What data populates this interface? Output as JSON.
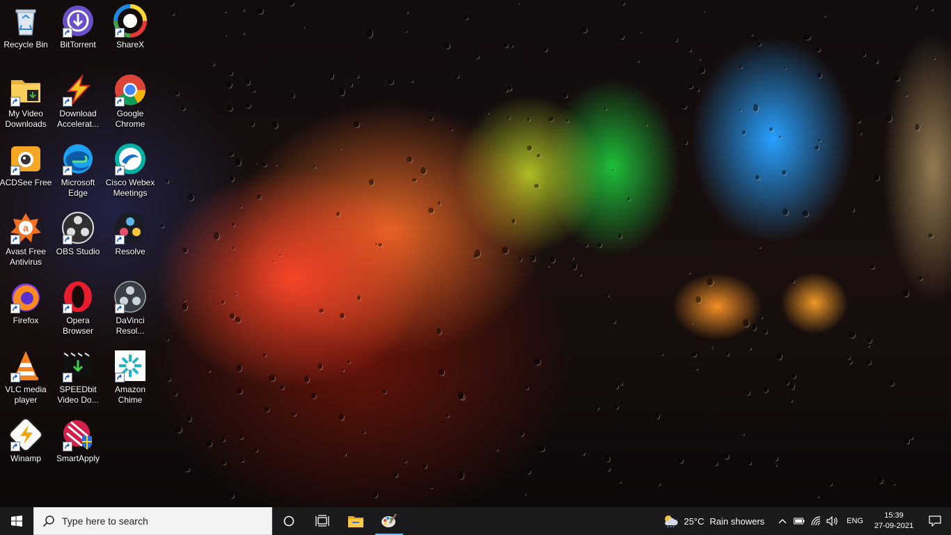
{
  "desktop": {
    "icons": [
      {
        "id": "recycle-bin",
        "label": "Recycle Bin",
        "icon": "recycle-bin-icon",
        "shortcut": false
      },
      {
        "id": "bittorrent",
        "label": "BitTorrent",
        "icon": "bittorrent-icon",
        "shortcut": true
      },
      {
        "id": "sharex",
        "label": "ShareX",
        "icon": "sharex-icon",
        "shortcut": true
      },
      {
        "id": "my-video-downloads",
        "label": "My Video Downloads",
        "icon": "folder-icon",
        "shortcut": true
      },
      {
        "id": "download-accelerator",
        "label": "Download Accelerat...",
        "icon": "download-accelerator-icon",
        "shortcut": true
      },
      {
        "id": "google-chrome",
        "label": "Google Chrome",
        "icon": "chrome-icon",
        "shortcut": true
      },
      {
        "id": "acdsee-free",
        "label": "ACDSee Free",
        "icon": "acdsee-icon",
        "shortcut": true
      },
      {
        "id": "microsoft-edge",
        "label": "Microsoft Edge",
        "icon": "edge-icon",
        "shortcut": true
      },
      {
        "id": "cisco-webex",
        "label": "Cisco Webex Meetings",
        "icon": "webex-icon",
        "shortcut": true
      },
      {
        "id": "avast",
        "label": "Avast Free Antivirus",
        "icon": "avast-icon",
        "shortcut": true
      },
      {
        "id": "obs-studio",
        "label": "OBS Studio",
        "icon": "obs-icon",
        "shortcut": true
      },
      {
        "id": "resolve",
        "label": "Resolve",
        "icon": "resolve-icon",
        "shortcut": true
      },
      {
        "id": "firefox",
        "label": "Firefox",
        "icon": "firefox-icon",
        "shortcut": true
      },
      {
        "id": "opera",
        "label": "Opera Browser",
        "icon": "opera-icon",
        "shortcut": true
      },
      {
        "id": "davinci",
        "label": "DaVinci Resol...",
        "icon": "davinci-icon",
        "shortcut": true
      },
      {
        "id": "vlc",
        "label": "VLC media player",
        "icon": "vlc-icon",
        "shortcut": true
      },
      {
        "id": "speedbit",
        "label": "SPEEDbit Video Do...",
        "icon": "speedbit-icon",
        "shortcut": true
      },
      {
        "id": "amazon-chime",
        "label": "Amazon Chime",
        "icon": "chime-icon",
        "shortcut": true
      },
      {
        "id": "winamp",
        "label": "Winamp",
        "icon": "winamp-icon",
        "shortcut": true
      },
      {
        "id": "smartapply",
        "label": "SmartApply",
        "icon": "smartapply-icon",
        "shortcut": true
      }
    ]
  },
  "taskbar": {
    "search_placeholder": "Type here to search",
    "weather_temp": "25°C",
    "weather_text": "Rain showers",
    "language": "ENG",
    "time": "15:39",
    "date": "27-09-2021"
  }
}
